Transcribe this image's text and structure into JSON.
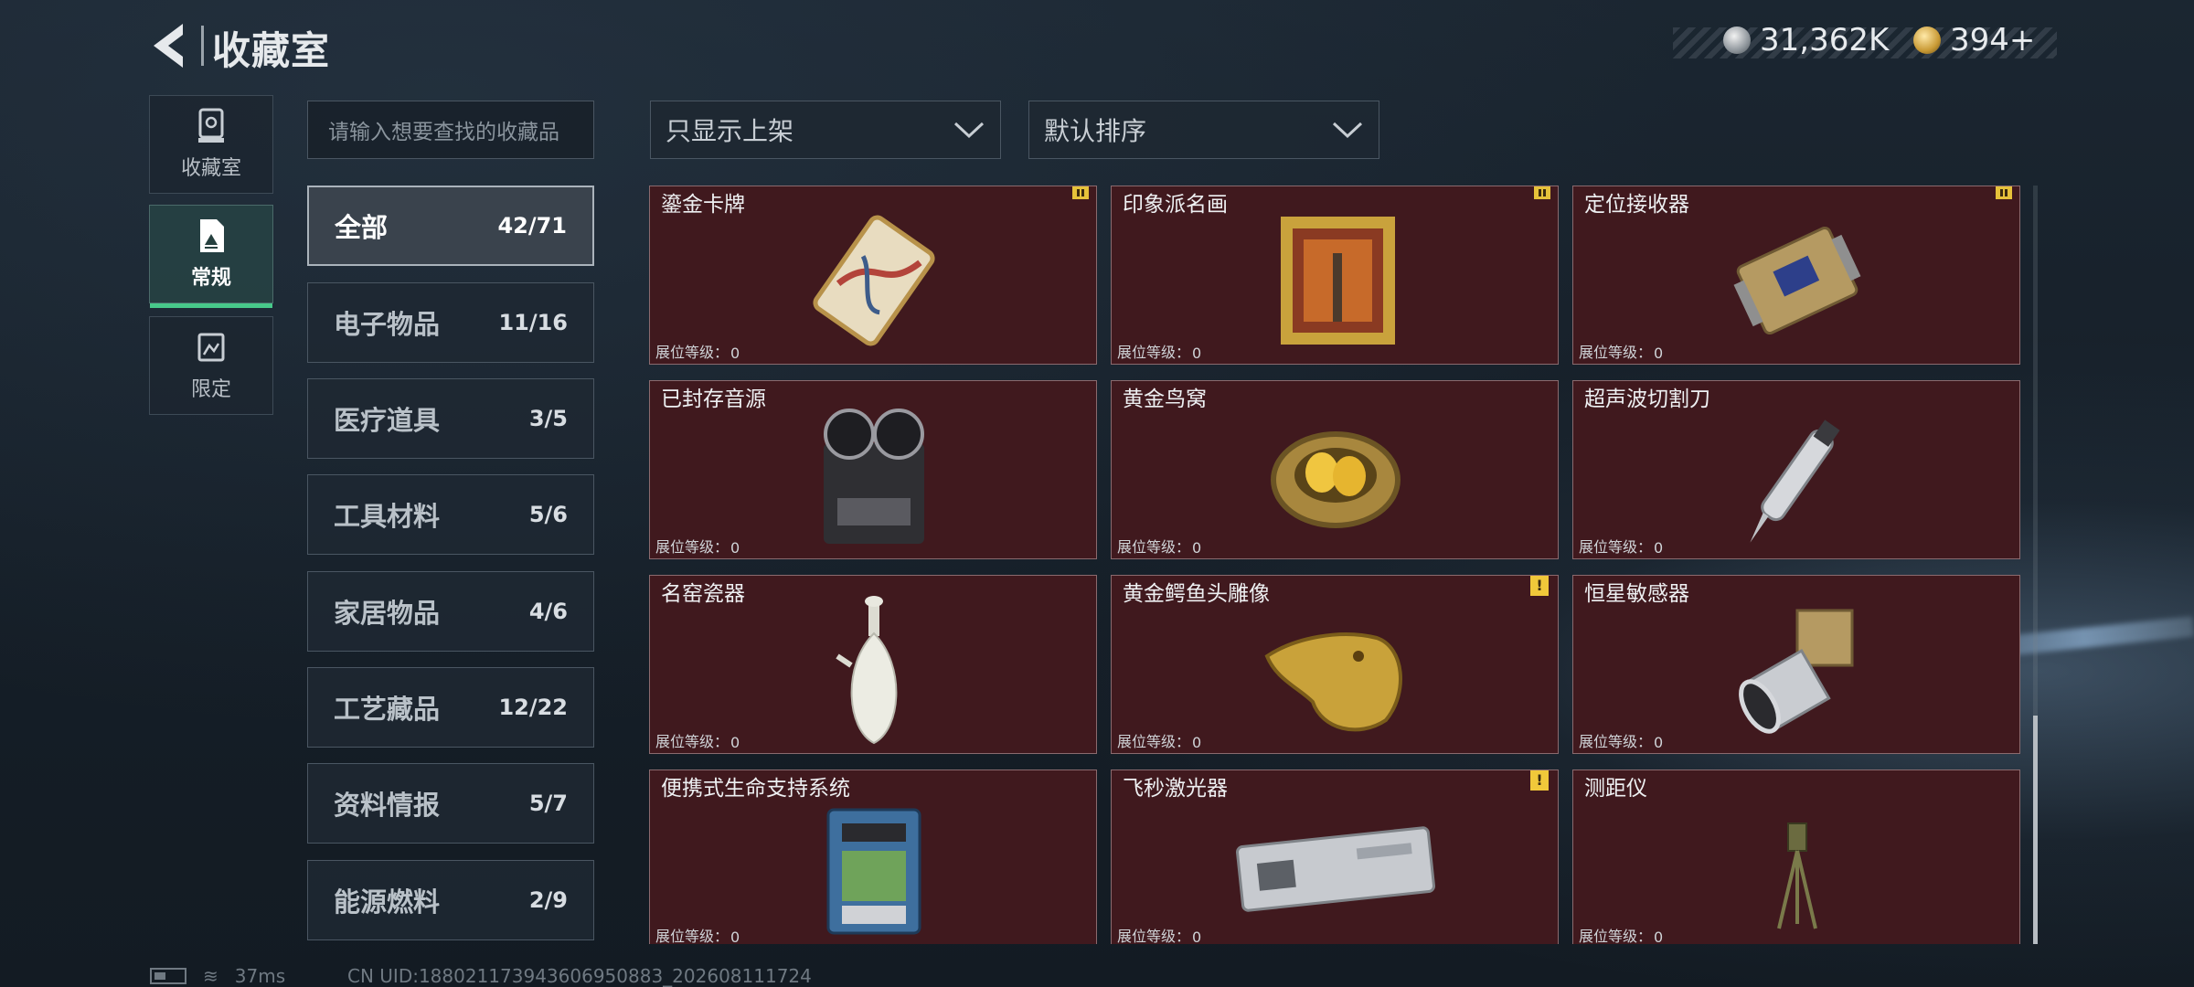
{
  "header": {
    "title": "收藏室",
    "silver": "31,362K",
    "gold": "394+"
  },
  "rail": [
    {
      "label": "收藏室",
      "icon": "display-case-icon"
    },
    {
      "label": "常规",
      "icon": "framed-picture-icon"
    },
    {
      "label": "限定",
      "icon": "limited-picture-icon"
    }
  ],
  "search": {
    "placeholder": "请输入想要查找的收藏品"
  },
  "filters": {
    "shelf": "只显示上架",
    "sort": "默认排序"
  },
  "categories": [
    {
      "name": "全部",
      "count": "42/71"
    },
    {
      "name": "电子物品",
      "count": "11/16"
    },
    {
      "name": "医疗道具",
      "count": "3/5"
    },
    {
      "name": "工具材料",
      "count": "5/6"
    },
    {
      "name": "家居物品",
      "count": "4/6"
    },
    {
      "name": "工艺藏品",
      "count": "12/22"
    },
    {
      "name": "资料情报",
      "count": "5/7"
    },
    {
      "name": "能源燃料",
      "count": "2/9"
    }
  ],
  "level_label": "展位等级：",
  "items": [
    {
      "name": "鎏金卡牌",
      "level": "0",
      "icon": "gilded-card-icon"
    },
    {
      "name": "印象派名画",
      "level": "0",
      "icon": "framed-painting-icon"
    },
    {
      "name": "定位接收器",
      "level": "0",
      "icon": "positioning-receiver-icon"
    },
    {
      "name": "已封存音源",
      "level": "0",
      "icon": "reel-tape-recorder-icon"
    },
    {
      "name": "黄金鸟窝",
      "level": "0",
      "icon": "golden-nest-icon"
    },
    {
      "name": "超声波切割刀",
      "level": "0",
      "icon": "ultrasonic-cutter-icon"
    },
    {
      "name": "名窑瓷器",
      "level": "0",
      "icon": "porcelain-vase-icon"
    },
    {
      "name": "黄金鳄鱼头雕像",
      "level": "0",
      "icon": "golden-crocodile-head-icon"
    },
    {
      "name": "恒星敏感器",
      "level": "0",
      "icon": "star-sensor-icon"
    },
    {
      "name": "便携式生命支持系统",
      "level": "0",
      "icon": "life-support-system-icon"
    },
    {
      "name": "飞秒激光器",
      "level": "0",
      "icon": "femtosecond-laser-icon"
    },
    {
      "name": "测距仪",
      "level": "0",
      "icon": "rangefinder-icon"
    }
  ],
  "footer": {
    "ping": "37ms",
    "uid": "CN UID:188021173943606950883_202608111724"
  }
}
